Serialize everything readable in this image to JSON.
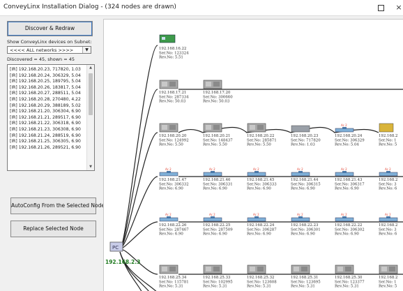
{
  "window": {
    "title": "ConveyLinx Installation Dialog - (324 nodes are drawn)",
    "maximize_glyph": "maximize-icon",
    "close_glyph": "×"
  },
  "left_panel": {
    "discover_button": "Discover & Redraw",
    "subnet_label": "Show ConveyLinx devices on Subnet:",
    "subnet_select_value": "<<<< ALL networks >>>>",
    "discovered_text": "Discovered = 45, shown = 45",
    "list_items": [
      "[IR] 192.168.20.23, 717820, 1.03",
      "[IR] 192.168.20.24, 306329, 5.04",
      "[IR] 192.168.20.25, 189795, 5.04",
      "[IR] 192.168.20.26, 183817, 5.04",
      "[IR] 192.168.20.27, 288511, 5.04",
      "[IR] 192.168.20.28, 270480, 4.22",
      "[IR] 192.168.20.29, 388189, 5.02",
      "[IR] 192.168.21.20, 306304, 6.90",
      "[IR] 192.168.21.21, 289517, 6.90",
      "[IR] 192.168.21.22, 306318, 6.90",
      "[IR] 192.168.21.23, 306308, 6.90",
      "[IR] 192.168.21.24, 288519, 6.90",
      "[IR] 192.168.21.25, 306305, 6.90",
      "[IR] 192.168.21.26, 289521, 6.90"
    ],
    "autoconfig_button": "AutoConfig From the Selected Node",
    "replace_button": "Replace Selected Node"
  },
  "colors": {
    "link_line": "#222222",
    "pc_ip": "#1f7a1f",
    "ac_label": "#e04030",
    "list_selected_border": "#3b78c4"
  },
  "canvas": {
    "pc_label": "PC",
    "pc_ip": "192.168.2.3",
    "rows": [
      {
        "nodes": [
          {
            "ip": "192.168.16.22",
            "ser": "Ser.No: 123324",
            "rev": "Rev.No: 5.51",
            "icon": "green-board"
          }
        ]
      },
      {
        "nodes": [
          {
            "ip": "192.168.17.21",
            "ser": "Ser.No: 287334",
            "rev": "Rev.No: 50.03",
            "icon": "gray-module"
          },
          {
            "ip": "192.168.17.20",
            "ser": "Ser.No: 300660",
            "rev": "Rev.No: 50.03",
            "icon": "gray-module"
          }
        ]
      },
      {
        "nodes": [
          {
            "ip": "192.168.20.20",
            "ser": "Ser.No: 124992",
            "rev": "Rev.No: 5.50",
            "icon": "gray-module"
          },
          {
            "ip": "192.168.20.21",
            "ser": "Ser.No: 148437",
            "rev": "Rev.No: 5.50",
            "icon": "gray-module"
          },
          {
            "ip": "192.168.20.22",
            "ser": "Ser.No: 285871",
            "rev": "Rev.No: 5.50",
            "icon": "gray-module"
          },
          {
            "ip": "192.168.20.23",
            "ser": "Ser.No: 717820",
            "rev": "Rev.No: 1.03",
            "icon": "flat-module"
          },
          {
            "ip": "192.168.20.24",
            "ser": "Ser.No: 306329",
            "rev": "Rev.No: 5.04",
            "icon": "ac-drive",
            "ac": "Ac 2"
          },
          {
            "ip": "192.168.2",
            "ser": "Ser.No: 1",
            "rev": "Rev.No: 5",
            "icon": "yellow-module"
          }
        ]
      },
      {
        "nodes": [
          {
            "ip": "192.168.21.47",
            "ser": "Ser.No: 306332",
            "rev": "Rev.No: 6.90",
            "icon": "ac-drive",
            "ac": "Ac 2"
          },
          {
            "ip": "192.168.21.46",
            "ser": "Ser.No: 306331",
            "rev": "Rev.No: 6.90",
            "icon": "ac-drive",
            "ac": "Ac 2"
          },
          {
            "ip": "192.168.21.45",
            "ser": "Ser.No: 306333",
            "rev": "Rev.No: 6.90",
            "icon": "ac-drive",
            "ac": "Ac 2"
          },
          {
            "ip": "192.168.21.44",
            "ser": "Ser.No: 306315",
            "rev": "Rev.No: 6.90",
            "icon": "ac-drive",
            "ac": "Ac 2"
          },
          {
            "ip": "192.168.21.43",
            "ser": "Ser.No: 306317",
            "rev": "Rev.No: 6.90",
            "icon": "ac-drive",
            "ac": "Ac 2"
          },
          {
            "ip": "192.168.2",
            "ser": "Ser.No: 3",
            "rev": "Rev.No: 6",
            "icon": "ac-drive",
            "ac": "Ac 2"
          }
        ]
      },
      {
        "nodes": [
          {
            "ip": "192.168.22.26",
            "ser": "Ser.No: 287467",
            "rev": "Rev.No: 6.90",
            "icon": "ac-drive",
            "ac": "Ac 2"
          },
          {
            "ip": "192.168.22.25",
            "ser": "Ser.No: 287509",
            "rev": "Rev.No: 6.90",
            "icon": "ac-drive",
            "ac": "Ac 2"
          },
          {
            "ip": "192.168.22.24",
            "ser": "Ser.No: 306287",
            "rev": "Rev.No: 6.90",
            "icon": "ac-drive",
            "ac": "Ac 2"
          },
          {
            "ip": "192.168.22.23",
            "ser": "Ser.No: 306301",
            "rev": "Rev.No: 6.90",
            "icon": "ac-drive",
            "ac": "Ac 2"
          },
          {
            "ip": "192.168.22.22",
            "ser": "Ser.No: 306302",
            "rev": "Rev.No: 6.90",
            "icon": "ac-drive",
            "ac": "Ac 2"
          },
          {
            "ip": "192.168.2",
            "ser": "Ser.No: 3",
            "rev": "Rev.No: 6",
            "icon": "ac-drive",
            "ac": "Ac 2"
          }
        ]
      },
      {
        "nodes": [
          {
            "ip": "192.168.25.34",
            "ser": "Ser.No: 115781",
            "rev": "Rev.No: 5.31",
            "icon": "gray-module"
          },
          {
            "ip": "192.168.25.33",
            "ser": "Ser.No: 102995",
            "rev": "Rev.No: 5.31",
            "icon": "gray-module"
          },
          {
            "ip": "192.168.25.32",
            "ser": "Ser.No: 123608",
            "rev": "Rev.No: 5.31",
            "icon": "gray-module"
          },
          {
            "ip": "192.168.25.31",
            "ser": "Ser.No: 123695",
            "rev": "Rev.No: 5.31",
            "icon": "gray-module"
          },
          {
            "ip": "192.168.25.30",
            "ser": "Ser.No: 123377",
            "rev": "Rev.No: 5.31",
            "icon": "gray-module"
          },
          {
            "ip": "192.168.2",
            "ser": "Ser.No: 1",
            "rev": "Rev.No: 5",
            "icon": "gray-module"
          }
        ]
      }
    ]
  }
}
